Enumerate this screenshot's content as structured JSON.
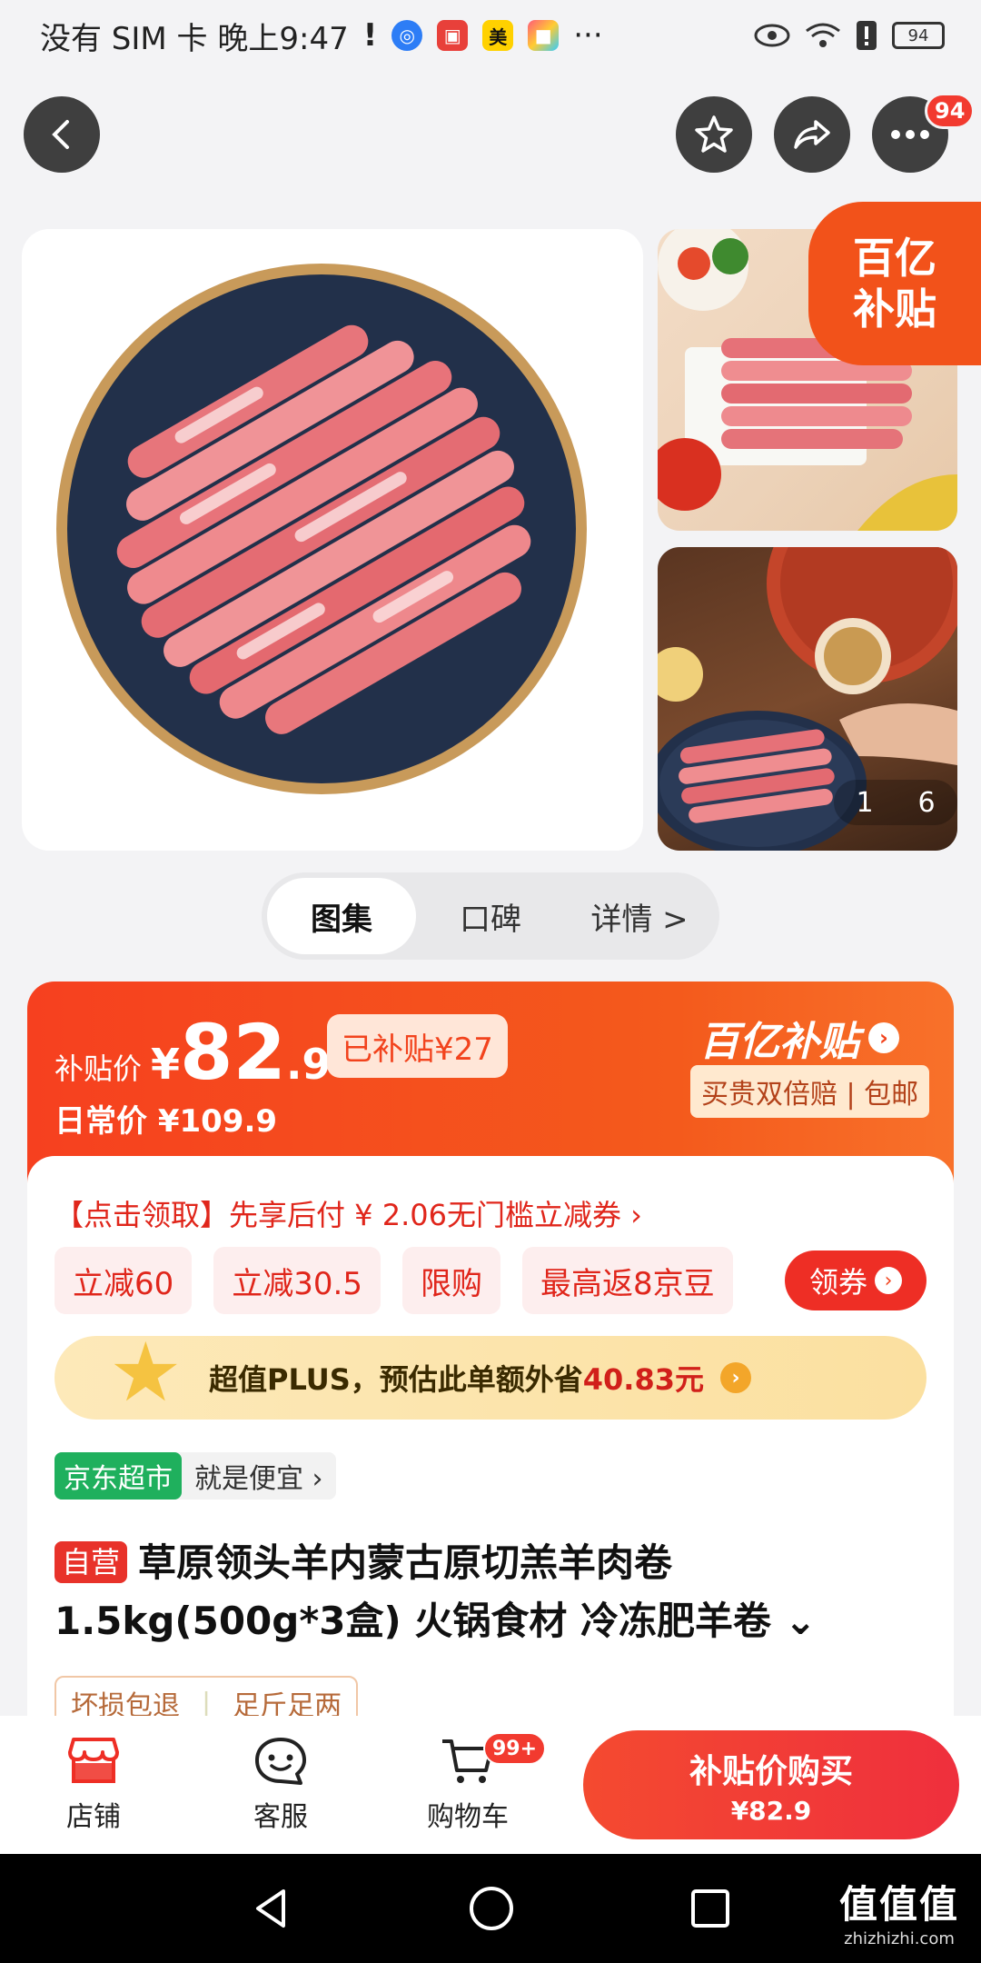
{
  "status_bar": {
    "carrier_time": "没有 SIM 卡 晚上9:47",
    "app_meituan": "美",
    "more": "···",
    "battery": "94"
  },
  "top_nav": {
    "message_badge": "94"
  },
  "gallery": {
    "yi_badge_line1": "百亿",
    "yi_badge_line2": "补贴",
    "page_current": "1",
    "page_total": "6"
  },
  "tabs": [
    {
      "label": "图集",
      "active": true
    },
    {
      "label": "口碑",
      "active": false
    },
    {
      "label": "详情 >",
      "active": false
    }
  ],
  "price": {
    "label": "补贴价",
    "yen": "¥",
    "integer": "82",
    "decimal": ".9",
    "subsidized": "已补贴¥27",
    "daily": "日常价 ¥109.9",
    "brand": "百亿补贴",
    "guarantee": "买贵双倍赔 | 包邮"
  },
  "coupons": {
    "line": "【点击领取】先享后付 ¥ 2.06无门槛立减券 ›",
    "chips": [
      "立减60",
      "立减30.5",
      "限购",
      "最高返8京豆"
    ],
    "claim": "领券"
  },
  "plus": {
    "text": "超值PLUS，预估此单额外省",
    "amount": "40.83元"
  },
  "store": {
    "tag": "京东超市",
    "slogan": "就是便宜 ›"
  },
  "product": {
    "self_tag": "自营",
    "title": "草原领头羊内蒙古原切羔羊肉卷 1.5kg(500g*3盒) 火锅食材 冷冻肥羊卷 ⌄",
    "policy": [
      "坏损包退",
      "足斤足两"
    ]
  },
  "bottom_bar": {
    "store": "店铺",
    "service": "客服",
    "cart": "购物车",
    "cart_badge": "99+",
    "buy_label": "补贴价购买",
    "buy_price": "¥82.9"
  },
  "watermark": {
    "big": "值值值",
    "small": "zhizhizhi.com"
  },
  "colors": {
    "accent": "#f2431d",
    "buy": "#ef2f3d",
    "jd_green": "#1fb05d"
  }
}
